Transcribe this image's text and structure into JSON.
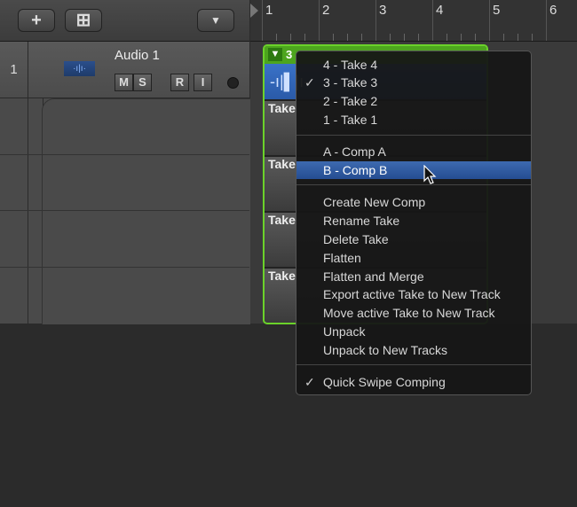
{
  "toolbar": {
    "add_track": "+",
    "new_folder": "⊞",
    "dropdown": "▼"
  },
  "ruler": {
    "bars": [
      "1",
      "2",
      "3",
      "4",
      "5",
      "6"
    ]
  },
  "track": {
    "number": "1",
    "name": "Audio 1",
    "mute": "M",
    "solo": "S",
    "record": "R",
    "input": "I"
  },
  "region": {
    "take_selector": "3",
    "take_labels": [
      "Take",
      "Take",
      "Take",
      "Take"
    ]
  },
  "menu": {
    "takes": [
      {
        "label": "4 - Take 4",
        "checked": false
      },
      {
        "label": "3 - Take 3",
        "checked": true
      },
      {
        "label": "2 - Take 2",
        "checked": false
      },
      {
        "label": "1 - Take 1",
        "checked": false
      }
    ],
    "comps": [
      {
        "label": "A - Comp A",
        "highlighted": false
      },
      {
        "label": "B - Comp B",
        "highlighted": true
      }
    ],
    "actions": [
      "Create New Comp",
      "Rename Take",
      "Delete Take",
      "Flatten",
      "Flatten and Merge",
      "Export active Take to New Track",
      "Move active Take to New Track",
      "Unpack",
      "Unpack to New Tracks"
    ],
    "quick_swipe": {
      "label": "Quick Swipe Comping",
      "checked": true
    },
    "check_mark": "✓"
  },
  "colors": {
    "region_border": "#6bd22a",
    "highlight": "#2f5ca3"
  }
}
